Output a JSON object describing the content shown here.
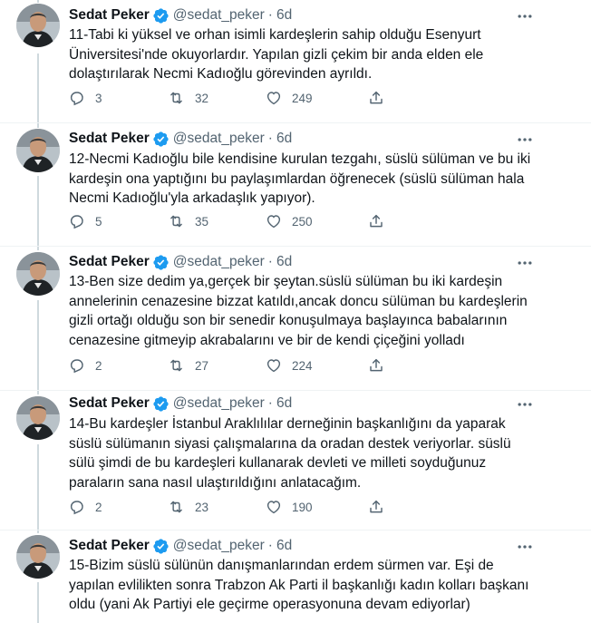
{
  "tweets": [
    {
      "name": "Sedat Peker",
      "handle": "@sedat_peker",
      "dot": "·",
      "time": "6d",
      "text": "11-Tabi ki yüksel ve orhan isimli kardeşlerin sahip olduğu Esenyurt Üniversitesi'nde okuyorlardır. Yapılan gizli çekim bir anda elden ele dolaştırılarak Necmi Kadıoğlu görevinden ayrıldı.",
      "replies": "3",
      "retweets": "32",
      "likes": "249"
    },
    {
      "name": "Sedat Peker",
      "handle": "@sedat_peker",
      "dot": "·",
      "time": "6d",
      "text": "12-Necmi Kadıoğlu bile kendisine kurulan tezgahı, süslü sülüman ve bu iki kardeşin ona yaptığını bu paylaşımlardan öğrenecek (süslü sülüman hala Necmi Kadıoğlu'yla arkadaşlık yapıyor).",
      "replies": "5",
      "retweets": "35",
      "likes": "250"
    },
    {
      "name": "Sedat Peker",
      "handle": "@sedat_peker",
      "dot": "·",
      "time": "6d",
      "text": "13-Ben size dedim ya,gerçek bir şeytan.süslü sülüman bu iki kardeşin annelerinin cenazesine bizzat katıldı,ancak doncu sülüman bu kardeşlerin gizli ortağı olduğu son bir senedir konuşulmaya başlayınca babalarının cenazesine gitmeyip akrabalarını ve bir de kendi çiçeğini yolladı",
      "replies": "2",
      "retweets": "27",
      "likes": "224"
    },
    {
      "name": "Sedat Peker",
      "handle": "@sedat_peker",
      "dot": "·",
      "time": "6d",
      "text": "14-Bu kardeşler İstanbul Araklılılar derneğinin başkanlığını da yaparak süslü sülümanın siyasi çalışmalarına da oradan destek veriyorlar. süslü sülü şimdi de bu kardeşleri kullanarak devleti ve milleti soyduğunuz paraların sana nasıl ulaştırıldığını anlatacağım.",
      "replies": "2",
      "retweets": "23",
      "likes": "190"
    },
    {
      "name": "Sedat Peker",
      "handle": "@sedat_peker",
      "dot": "·",
      "time": "6d",
      "text": "15-Bizim süslü sülünün danışmanlarından erdem sürmen var. Eşi de yapılan evlilikten sonra Trabzon Ak Parti il başkanlığı kadın kolları başkanı oldu (yani Ak Partiyi ele geçirme operasyonuna devam ediyorlar)",
      "replies": "",
      "retweets": "",
      "likes": ""
    }
  ],
  "icons": {
    "verified": "verified-badge-icon",
    "more": "more-dots-icon",
    "reply": "reply-icon",
    "retweet": "retweet-icon",
    "like": "like-icon",
    "share": "share-icon"
  },
  "colors": {
    "verified": "#1d9bf0",
    "secondary_text": "#536471",
    "primary_text": "#0f1419",
    "thread_line": "#cfd9de"
  }
}
